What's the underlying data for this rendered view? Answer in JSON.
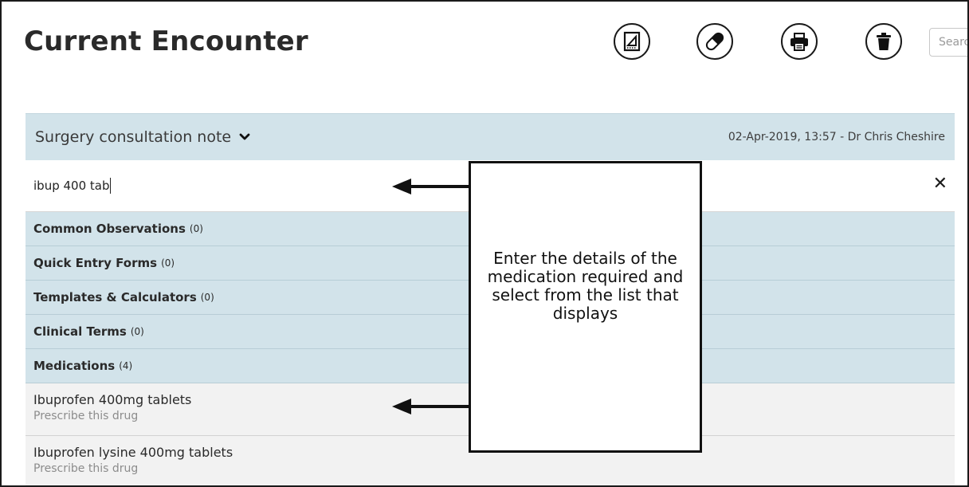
{
  "page": {
    "title": "Current Encounter"
  },
  "toolbar": {
    "search_placeholder": "Search",
    "icons": [
      "note-pad-icon",
      "capsule-icon",
      "printer-icon",
      "trash-can-icon"
    ]
  },
  "note": {
    "title": "Surgery consultation note",
    "meta": "02-Apr-2019, 13:57 - Dr Chris Cheshire"
  },
  "entry": {
    "value": "ibup 400 tab",
    "clear": "✕"
  },
  "categories": [
    {
      "label": "Common Observations",
      "count": "(0)"
    },
    {
      "label": "Quick Entry Forms",
      "count": "(0)"
    },
    {
      "label": "Templates & Calculators",
      "count": "(0)"
    },
    {
      "label": "Clinical Terms",
      "count": "(0)"
    },
    {
      "label": "Medications",
      "count": "(4)"
    }
  ],
  "medications": [
    {
      "name": "Ibuprofen 400mg tablets",
      "action": "Prescribe this drug"
    },
    {
      "name": "Ibuprofen lysine 400mg tablets",
      "action": "Prescribe this drug"
    }
  ],
  "callout": {
    "text": "Enter the details of the medication required and select from the list that displays"
  },
  "colors": {
    "header_bg": "#d2e3ea",
    "result_bg": "#f2f2f2"
  }
}
